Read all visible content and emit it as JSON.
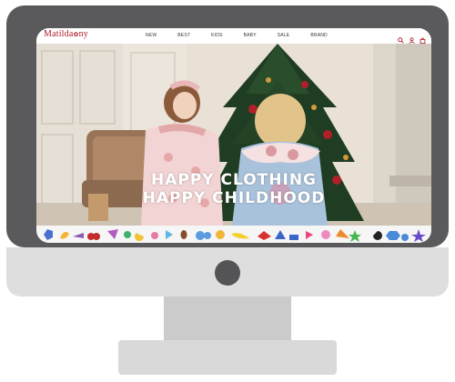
{
  "site": {
    "logo": "Matilda",
    "logo_tail": "ny"
  },
  "nav": {
    "items": [
      "NEW",
      "BEST",
      "KIDS",
      "BABY",
      "SALE",
      "BRAND"
    ]
  },
  "header_icons": [
    "search-icon",
    "user-icon",
    "bag-icon"
  ],
  "hero": {
    "line1": "HAPPY CLOTHING",
    "line2": "HAPPY CHILDHOOD"
  },
  "colors": {
    "brand": "#b01c2a",
    "bezel": "#5a5a5c",
    "chin": "#dedede"
  }
}
